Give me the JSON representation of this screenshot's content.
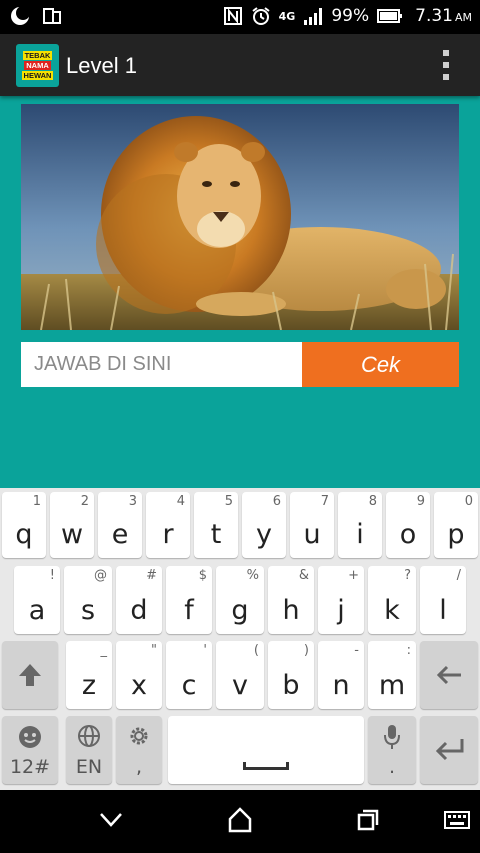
{
  "status_bar": {
    "battery": "99%",
    "time": "7.31",
    "ampm": "AM",
    "network": "4G"
  },
  "app": {
    "logo_lines": [
      "TEBAK",
      "NAMA",
      "HEWAN"
    ],
    "title": "Level 1",
    "overflow_icon": "more-vert-icon"
  },
  "picture": {
    "subject": "lion"
  },
  "answer": {
    "placeholder": "JAWAB DI SINI",
    "value": ""
  },
  "check_button": {
    "label": "Cek",
    "color": "#ef6f1f"
  },
  "colors": {
    "background": "#0aa39a",
    "app_bar": "#232323"
  },
  "keyboard": {
    "row1": [
      {
        "k": "q",
        "h": "1"
      },
      {
        "k": "w",
        "h": "2"
      },
      {
        "k": "e",
        "h": "3"
      },
      {
        "k": "r",
        "h": "4"
      },
      {
        "k": "t",
        "h": "5"
      },
      {
        "k": "y",
        "h": "6"
      },
      {
        "k": "u",
        "h": "7"
      },
      {
        "k": "i",
        "h": "8"
      },
      {
        "k": "o",
        "h": "9"
      },
      {
        "k": "p",
        "h": "0"
      }
    ],
    "row2": [
      {
        "k": "a",
        "h": "!"
      },
      {
        "k": "s",
        "h": "@"
      },
      {
        "k": "d",
        "h": "#"
      },
      {
        "k": "f",
        "h": "$"
      },
      {
        "k": "g",
        "h": "%"
      },
      {
        "k": "h",
        "h": "&"
      },
      {
        "k": "j",
        "h": "+"
      },
      {
        "k": "k",
        "h": "?"
      },
      {
        "k": "l",
        "h": "/"
      }
    ],
    "row3": [
      {
        "k": "z",
        "h": "_"
      },
      {
        "k": "x",
        "h": "\""
      },
      {
        "k": "c",
        "h": "'"
      },
      {
        "k": "v",
        "h": "("
      },
      {
        "k": "b",
        "h": ")"
      },
      {
        "k": "n",
        "h": "-"
      },
      {
        "k": "m",
        "h": ":"
      }
    ],
    "symbols_label": "12#",
    "language_label": "EN",
    "comma_label": ",",
    "period_label": "."
  }
}
